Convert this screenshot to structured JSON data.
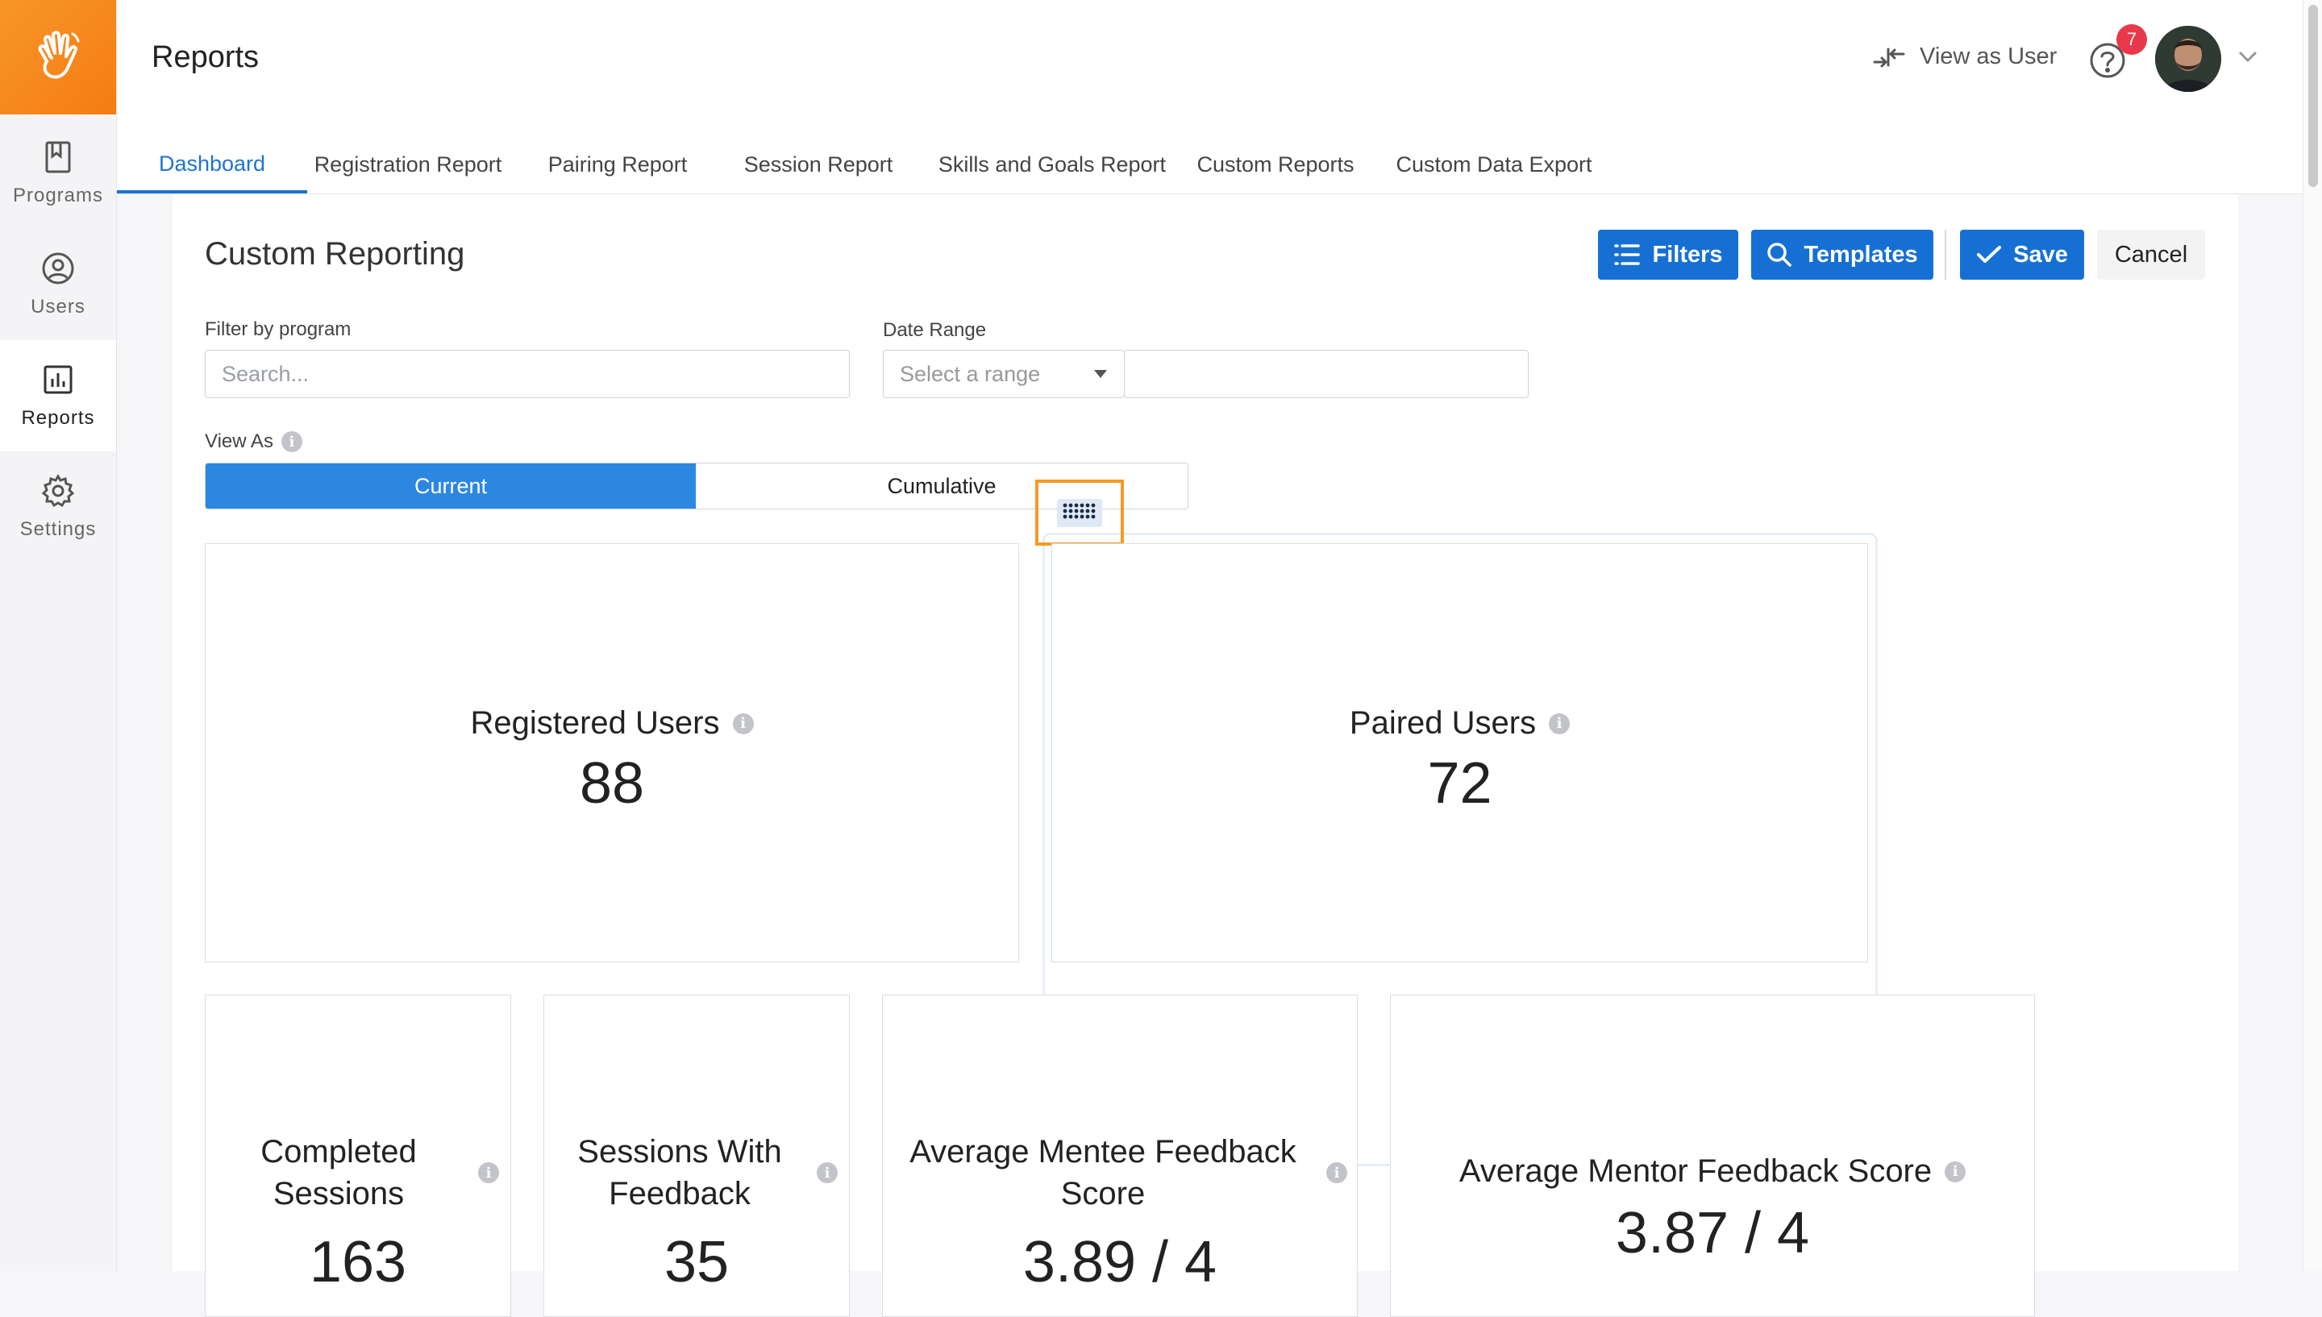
{
  "app": {
    "page_title": "Reports",
    "view_as_user": "View as User",
    "notification_count": "7",
    "accent_color": "#1670d4",
    "brand_color": "#f7962a"
  },
  "sidebar": {
    "items": [
      {
        "label": "Programs",
        "icon": "bookmark-icon"
      },
      {
        "label": "Users",
        "icon": "user-circle-icon"
      },
      {
        "label": "Reports",
        "icon": "bar-chart-icon",
        "active": true
      },
      {
        "label": "Settings",
        "icon": "gear-icon"
      }
    ]
  },
  "tabs": [
    {
      "label": "Dashboard",
      "active": true
    },
    {
      "label": "Registration Report"
    },
    {
      "label": "Pairing Report"
    },
    {
      "label": "Session Report"
    },
    {
      "label": "Skills and Goals Report"
    },
    {
      "label": "Custom Reports"
    },
    {
      "label": "Custom Data Export"
    }
  ],
  "custom": {
    "title": "Custom Reporting",
    "buttons": {
      "filters": "Filters",
      "templates": "Templates",
      "save": "Save",
      "cancel": "Cancel"
    },
    "filter_program": {
      "label": "Filter by program",
      "placeholder": "Search..."
    },
    "date_range": {
      "label": "Date Range",
      "select_value": "Select a range",
      "end_value": ""
    },
    "view_as": {
      "label": "View As",
      "options": [
        "Current",
        "Cumulative"
      ],
      "selected": "Current"
    }
  },
  "cards": {
    "registered": {
      "title": "Registered Users",
      "value": "88"
    },
    "paired": {
      "title": "Paired Users",
      "value": "72"
    },
    "completed": {
      "title_line1": "Completed",
      "title_line2": "Sessions",
      "value": "163"
    },
    "feedback": {
      "title_line1": "Sessions With",
      "title_line2": "Feedback",
      "value": "35"
    },
    "mentee": {
      "title_line1": "Average Mentee Feedback",
      "title_line2": "Score",
      "value": "3.89 / 4"
    },
    "mentor": {
      "title": "Average Mentor Feedback Score",
      "value": "3.87 / 4"
    }
  }
}
